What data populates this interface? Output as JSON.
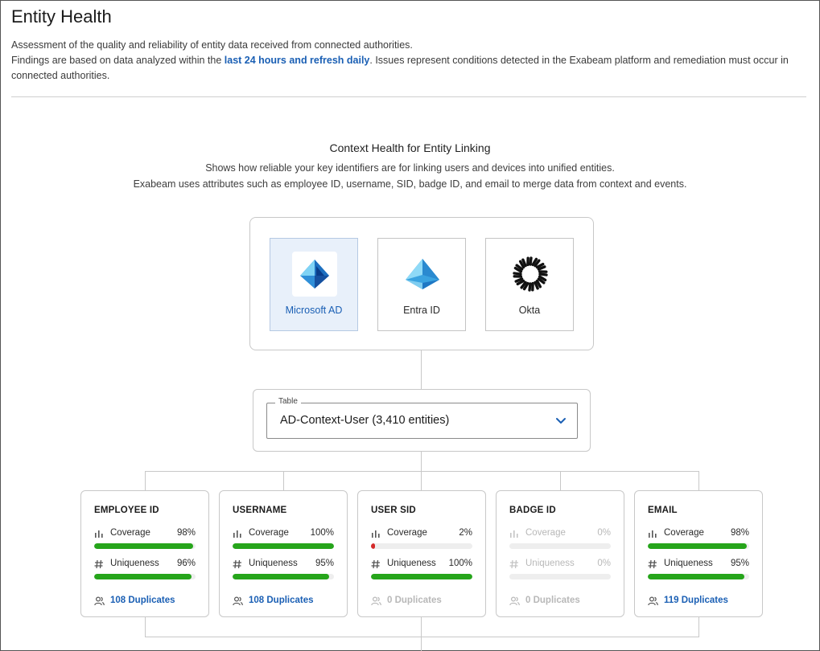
{
  "page": {
    "title": "Entity Health",
    "desc_line1": "Assessment of the quality and reliability of entity data received from connected authorities.",
    "desc_line2_pre": "Findings are based on data analyzed within the ",
    "desc_line2_link": "last 24 hours and refresh daily",
    "desc_line2_post": ". Issues represent conditions detected in the Exabeam platform and remediation must occur in connected authorities."
  },
  "section": {
    "title": "Context Health for Entity Linking",
    "sub1": "Shows how reliable your key identifiers are for linking users and devices into unified entities.",
    "sub2": "Exabeam uses attributes such as employee ID, username, SID, badge ID, and email to merge data from context and events."
  },
  "authorities": [
    {
      "label": "Microsoft AD",
      "icon": "microsoft-ad-icon",
      "selected": true
    },
    {
      "label": "Entra ID",
      "icon": "entra-id-icon",
      "selected": false
    },
    {
      "label": "Okta",
      "icon": "okta-icon",
      "selected": false
    }
  ],
  "table_select": {
    "legend": "Table",
    "value": "AD-Context-User (3,410 entities)"
  },
  "colors": {
    "accent": "#1a5fb4",
    "good": "#26a51b",
    "bad": "#d42a2a",
    "muted": "#b8b8b8"
  },
  "cards": [
    {
      "title": "EMPLOYEE ID",
      "coverage_label": "Coverage",
      "coverage": "98%",
      "coverage_pct": 98,
      "uniqueness_label": "Uniqueness",
      "uniqueness": "96%",
      "uniqueness_pct": 96,
      "duplicates": "108 Duplicates"
    },
    {
      "title": "USERNAME",
      "coverage_label": "Coverage",
      "coverage": "100%",
      "coverage_pct": 100,
      "uniqueness_label": "Uniqueness",
      "uniqueness": "95%",
      "uniqueness_pct": 95,
      "duplicates": "108 Duplicates"
    },
    {
      "title": "USER SID",
      "coverage_label": "Coverage",
      "coverage": "2%",
      "coverage_pct": 2,
      "uniqueness_label": "Uniqueness",
      "uniqueness": "100%",
      "uniqueness_pct": 100,
      "duplicates": "0 Duplicates"
    },
    {
      "title": "BADGE ID",
      "coverage_label": "Coverage",
      "coverage": "0%",
      "coverage_pct": 0,
      "uniqueness_label": "Uniqueness",
      "uniqueness": "0%",
      "uniqueness_pct": 0,
      "duplicates": "0 Duplicates"
    },
    {
      "title": "EMAIL",
      "coverage_label": "Coverage",
      "coverage": "98%",
      "coverage_pct": 98,
      "uniqueness_label": "Uniqueness",
      "uniqueness": "95%",
      "uniqueness_pct": 95,
      "duplicates": "119 Duplicates"
    }
  ]
}
